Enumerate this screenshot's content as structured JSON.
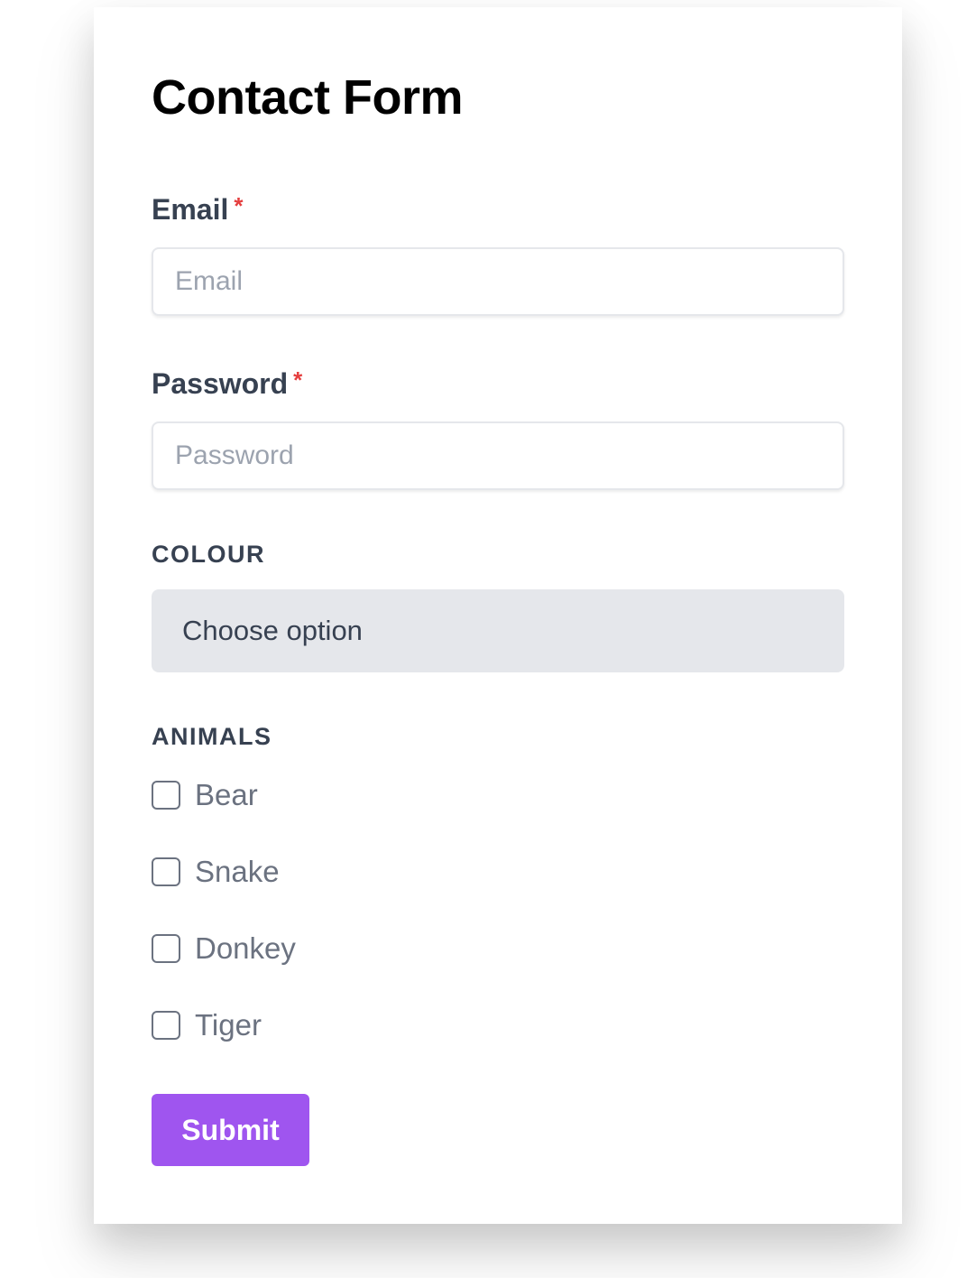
{
  "form": {
    "title": "Contact Form",
    "email": {
      "label": "Email",
      "required_marker": "*",
      "placeholder": "Email",
      "value": ""
    },
    "password": {
      "label": "Password",
      "required_marker": "*",
      "placeholder": "Password",
      "value": ""
    },
    "colour": {
      "label": "COLOUR",
      "selected": "Choose option"
    },
    "animals": {
      "label": "ANIMALS",
      "options": [
        {
          "label": "Bear",
          "checked": false
        },
        {
          "label": "Snake",
          "checked": false
        },
        {
          "label": "Donkey",
          "checked": false
        },
        {
          "label": "Tiger",
          "checked": false
        }
      ]
    },
    "submit_label": "Submit"
  },
  "colors": {
    "accent": "#9f55ef",
    "required": "#e53e3e",
    "label_text": "#374151",
    "select_bg": "#e5e7eb"
  }
}
